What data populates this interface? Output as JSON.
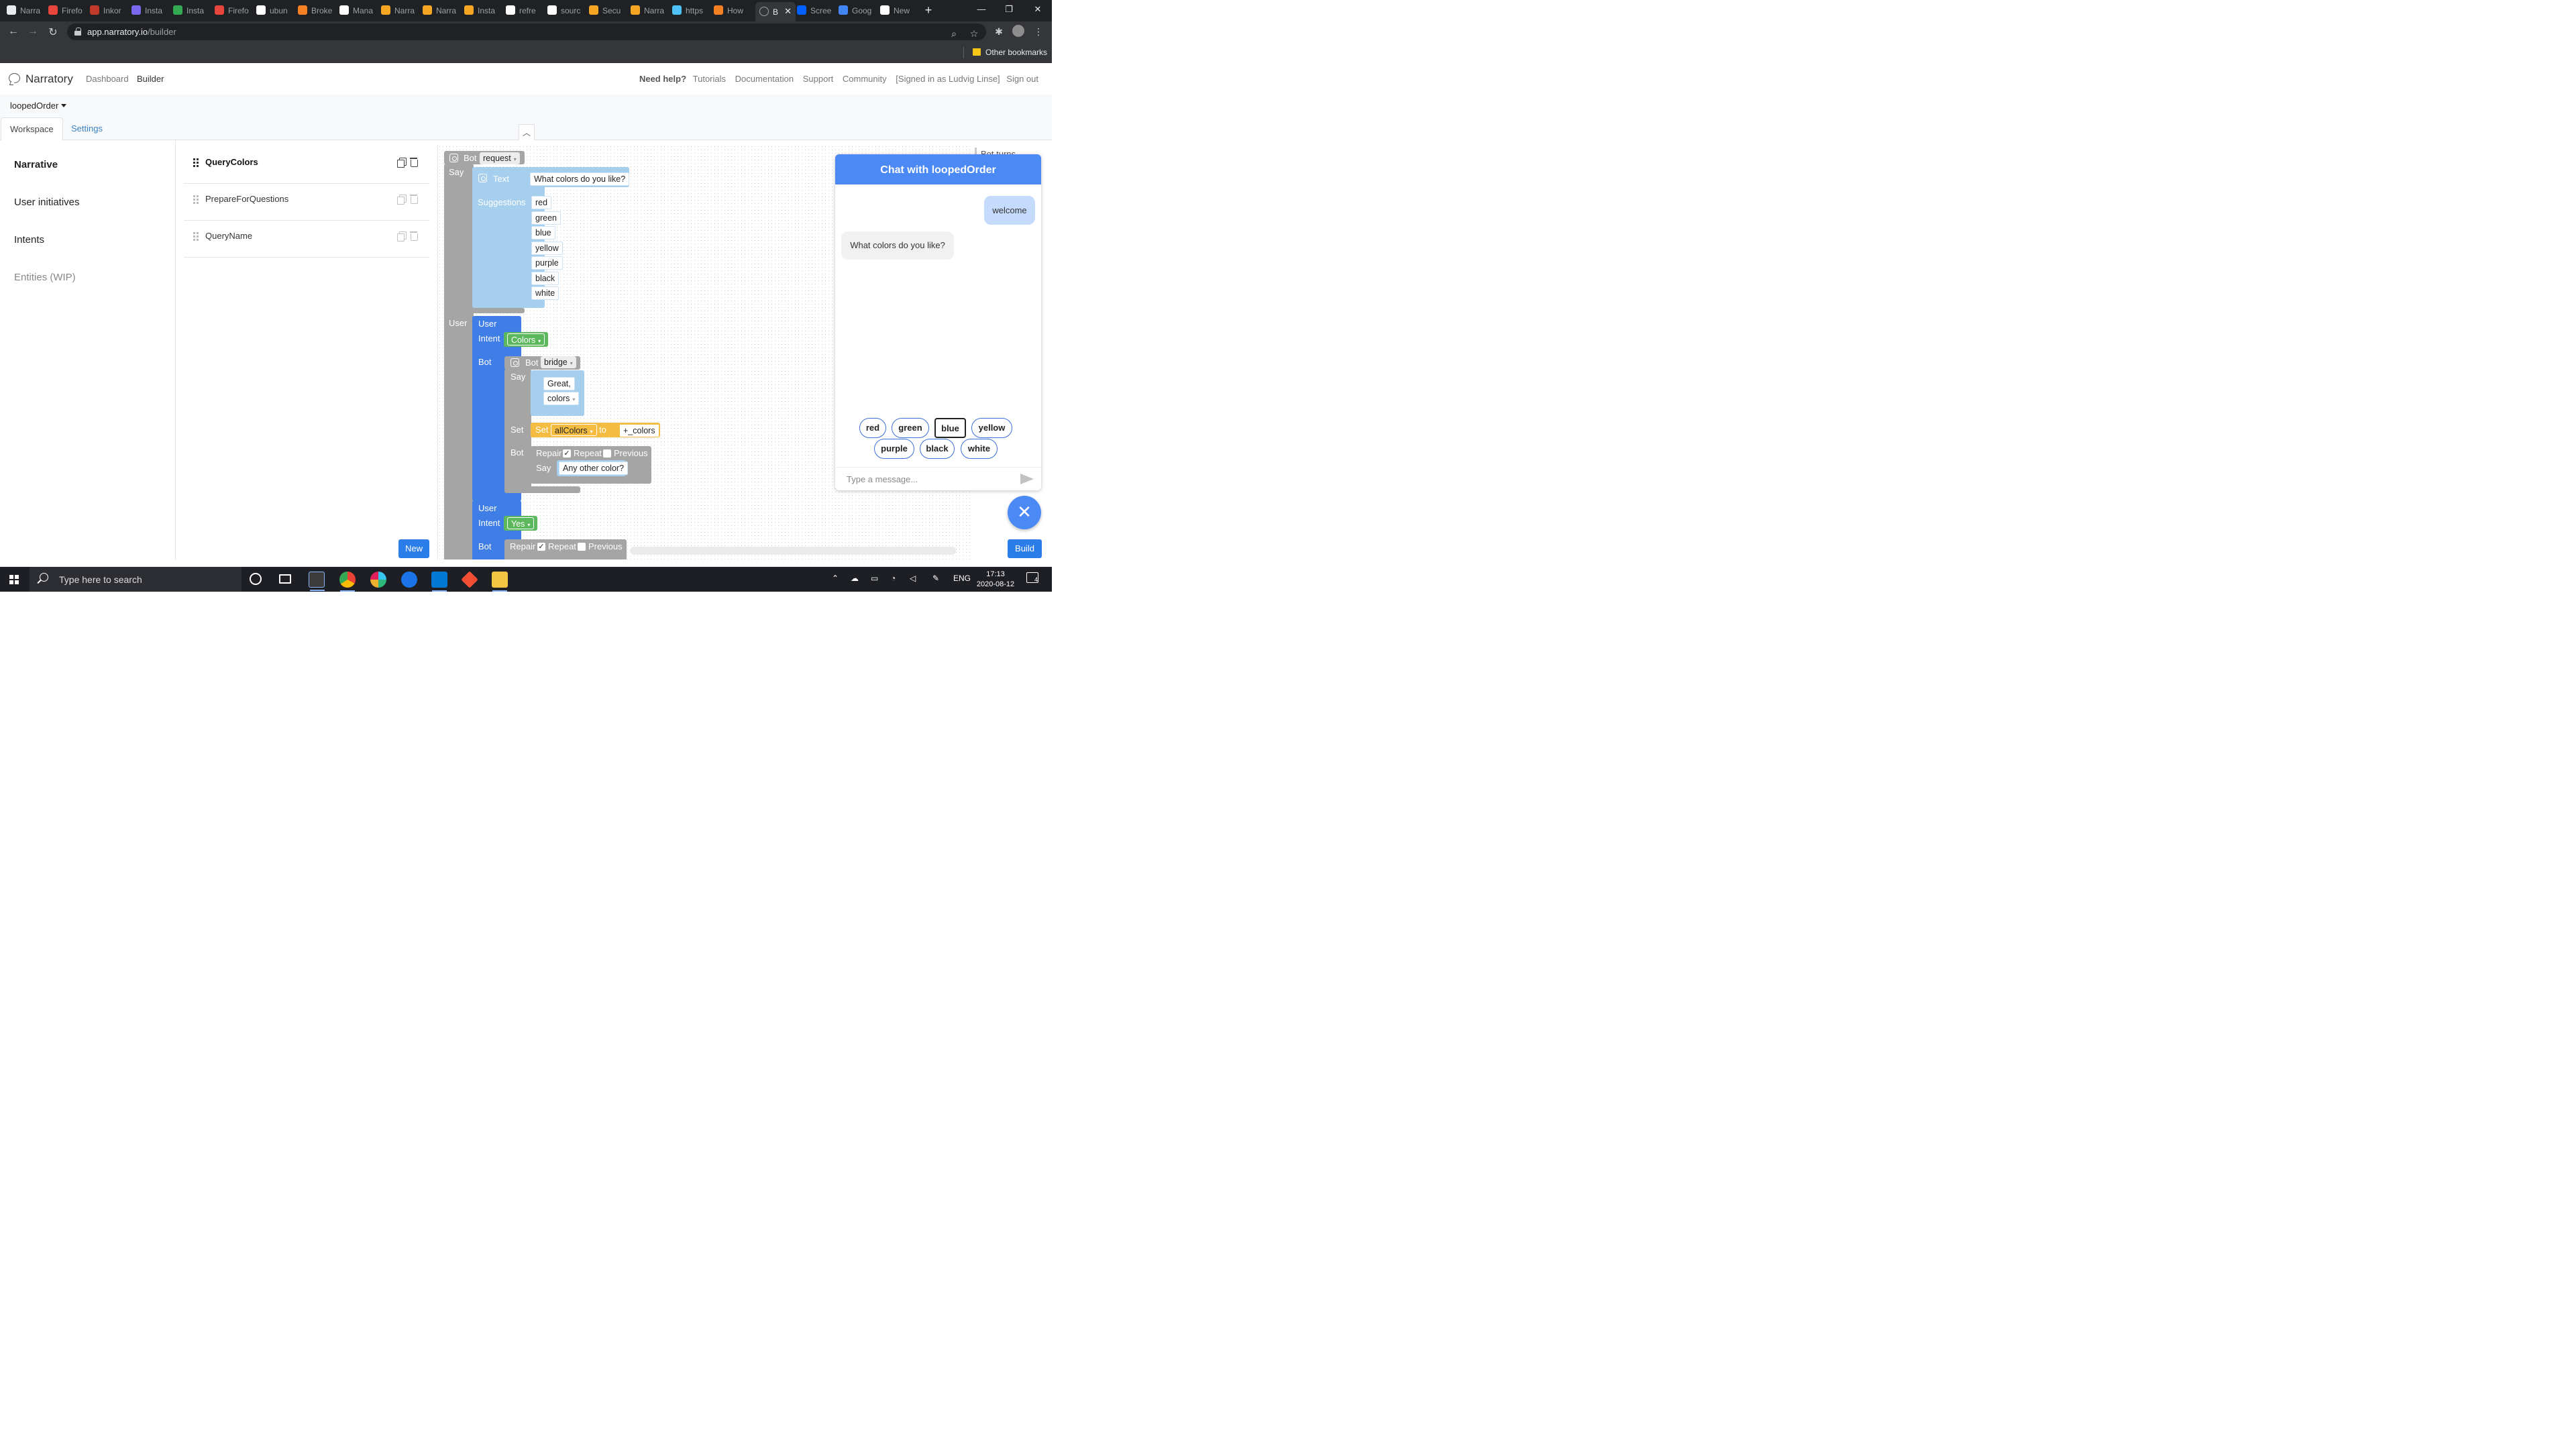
{
  "browser": {
    "tabs": [
      {
        "label": "Narra",
        "color": "#e8eaed"
      },
      {
        "label": "Firefo",
        "color": "#e8453c"
      },
      {
        "label": "Inkor",
        "color": "#c0392b"
      },
      {
        "label": "Insta",
        "color": "#7b68ee"
      },
      {
        "label": "Insta",
        "color": "#34a853"
      },
      {
        "label": "Firefo",
        "color": "#e8453c"
      },
      {
        "label": "ubun",
        "color": "#ffffff"
      },
      {
        "label": "Broke",
        "color": "#f48024"
      },
      {
        "label": "Mana",
        "color": "#ffffff"
      },
      {
        "label": "Narra",
        "color": "#f5a623"
      },
      {
        "label": "Narra",
        "color": "#f5a623"
      },
      {
        "label": "Insta",
        "color": "#f5a623"
      },
      {
        "label": "refre",
        "color": "#ffffff"
      },
      {
        "label": "sourc",
        "color": "#ffffff"
      },
      {
        "label": "Secu",
        "color": "#f5a623"
      },
      {
        "label": "Narra",
        "color": "#f5a623"
      },
      {
        "label": "https",
        "color": "#4fc3f7"
      },
      {
        "label": "How",
        "color": "#f48024"
      },
      {
        "label": "B",
        "color": "#9aa0a6",
        "active": true
      },
      {
        "label": "Scree",
        "color": "#0061fe"
      },
      {
        "label": "Goog",
        "color": "#4285f4"
      },
      {
        "label": "New",
        "color": "#ffffff"
      }
    ],
    "url_host": "app.narratory.io",
    "url_path": "/builder",
    "bookmark_folder": "Other bookmarks"
  },
  "app": {
    "brand": "Narratory",
    "nav": [
      "Dashboard",
      "Builder"
    ],
    "help_label": "Need help?",
    "help_links": [
      "Tutorials",
      "Documentation",
      "Support",
      "Community",
      "[Signed in as Ludvig Linse]",
      "Sign out"
    ],
    "project": "loopedOrder",
    "tabs": [
      "Workspace",
      "Settings"
    ],
    "collapse_icon": "chevron-up-icon"
  },
  "sidebar": {
    "items": [
      {
        "label": "Narrative"
      },
      {
        "label": "User initiatives"
      },
      {
        "label": "Intents"
      },
      {
        "label": "Entities (WIP)"
      }
    ]
  },
  "narratives": {
    "items": [
      {
        "name": "QueryColors"
      },
      {
        "name": "PrepareForQuestions"
      },
      {
        "name": "QueryName"
      }
    ],
    "new_button": "New"
  },
  "blocks": {
    "bot_kw": "Bot",
    "request": "request",
    "say": "Say",
    "text_kw": "Text",
    "question": "What colors do you like?",
    "suggestions_kw": "Suggestions",
    "suggestions": [
      "red",
      "green",
      "blue",
      "yellow",
      "purple",
      "black",
      "white"
    ],
    "user_kw": "User",
    "intent_kw": "Intent",
    "colors_intent": "Colors",
    "bridge": "bridge",
    "great": "Great,",
    "colors_var": "colors",
    "set_kw": "Set",
    "all_colors": "allColors",
    "to_kw": "to",
    "plus_colors": "+_colors",
    "repair_kw": "Repair",
    "repeat_kw": "Repeat",
    "previous_kw": "Previous",
    "any_other": "Any other color?",
    "yes_intent": "Yes",
    "bot_types_label": "Bot turns"
  },
  "chat": {
    "title": "Chat with loopedOrder",
    "user_message": "welcome",
    "bot_message": "What colors do you like?",
    "chips": [
      "red",
      "green",
      "blue",
      "yellow",
      "purple",
      "black",
      "white"
    ],
    "placeholder": "Type a message...",
    "close_icon": "close-icon",
    "build_button": "Build"
  },
  "taskbar": {
    "search_placeholder": "Type here to search",
    "language": "ENG",
    "time": "17:13",
    "date": "2020-08-12",
    "notification_count": "4"
  }
}
